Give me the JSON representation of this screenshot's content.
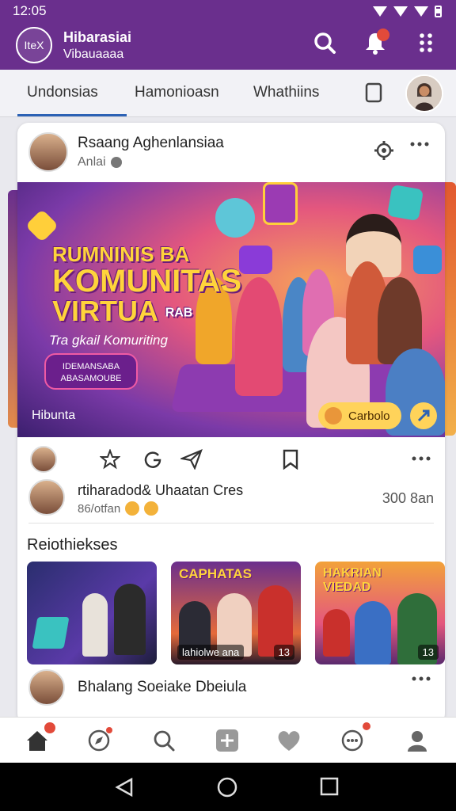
{
  "status_bar": {
    "time": "12:05"
  },
  "header": {
    "logo_text": "IteX",
    "title": "Hibarasiai",
    "subtitle": "Vibauaaaa",
    "icons": [
      "search-icon",
      "bell-icon",
      "more-vertical-icon"
    ]
  },
  "tabs": [
    {
      "label": "Undonsias",
      "active": true
    },
    {
      "label": "Hamonioasn",
      "active": false
    },
    {
      "label": "Whathiins",
      "active": false
    }
  ],
  "post": {
    "author": "Rsaang Aghenlansiaa",
    "meta": "Anlai",
    "banner": {
      "line1": "RUMNINIS BA",
      "line2": "KOMUNITAS",
      "line3": "VIRTUA",
      "line3_tag": "RAB",
      "subtitle": "Tra gkail Komuriting",
      "chip_line1": "IDEMANSABA",
      "chip_line2": "ABASAMOUBE",
      "footer": "Hibunta",
      "button_label": "Carbolo"
    },
    "comment": {
      "name": "rtiharadod& Uhaatan Cres",
      "meta": "86/otfan",
      "count": "300 8an"
    }
  },
  "section": {
    "title": "Reiothiekses",
    "thumbnails": [
      {
        "title": "",
        "label": "",
        "count": ""
      },
      {
        "title": "CAPHATAS",
        "label": "lahiolwe ana",
        "count": "13"
      },
      {
        "title": "HAKRIAN VIEDAD",
        "label": "",
        "count": "13"
      }
    ]
  },
  "suggestion": {
    "name": "Bhalang Soeiake Dbeiula"
  },
  "bottom_nav": [
    "home-icon",
    "explore-icon",
    "search-icon",
    "add-icon",
    "heart-icon",
    "messages-icon",
    "profile-icon"
  ],
  "colors": {
    "primary": "#6a2f8d",
    "accent": "#2c62b5",
    "badge": "#e24a3a"
  }
}
